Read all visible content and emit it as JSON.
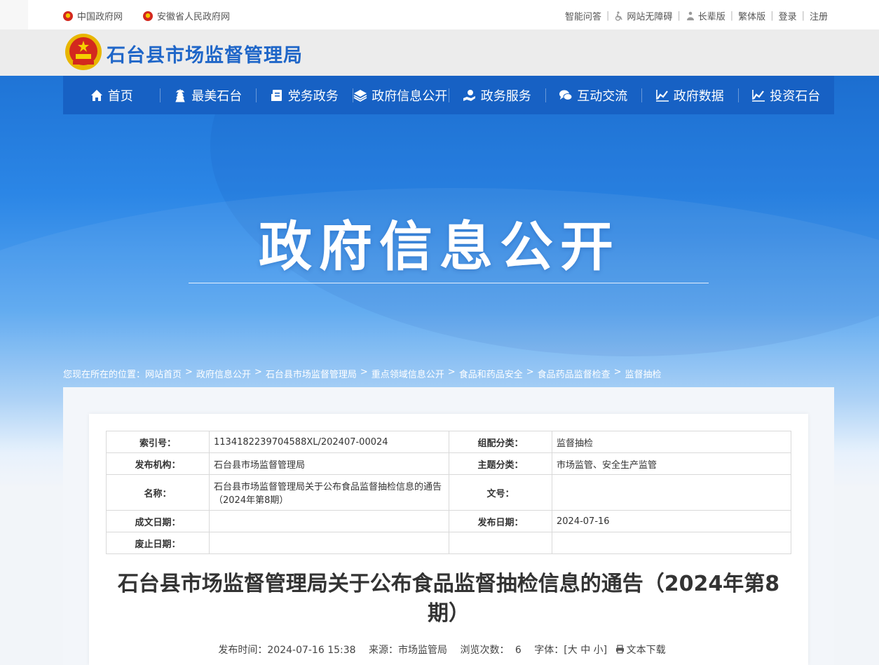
{
  "topbar": {
    "left_links": [
      "中国政府网",
      "安徽省人民政府网"
    ],
    "right_links": {
      "qa": "智能问答",
      "accessible": "网站无障碍",
      "elder": "长辈版",
      "traditional": "繁体版",
      "login": "登录",
      "register": "注册"
    }
  },
  "header": {
    "site_title": "石台县市场监督管理局"
  },
  "nav": {
    "items": [
      {
        "label": "首页",
        "icon": "home-icon"
      },
      {
        "label": "最美石台",
        "icon": "pagoda-icon"
      },
      {
        "label": "党务政务",
        "icon": "document-icon"
      },
      {
        "label": "政府信息公开",
        "icon": "layers-icon"
      },
      {
        "label": "政务服务",
        "icon": "hand-service-icon"
      },
      {
        "label": "互动交流",
        "icon": "chat-icon"
      },
      {
        "label": "政府数据",
        "icon": "chart-icon"
      },
      {
        "label": "投资石台",
        "icon": "chart-icon"
      }
    ]
  },
  "banner": {
    "title": "政府信息公开"
  },
  "breadcrumb": {
    "prefix": "您现在所在的位置：",
    "items": [
      "网站首页",
      "政府信息公开",
      "石台县市场监督管理局",
      "重点领域信息公开",
      "食品和药品安全",
      "食品药品监督检查",
      "监督抽检"
    ],
    "separator": ">"
  },
  "meta_table": {
    "index_label": "索引号：",
    "index_value": "1134182239704588XL/202407-00024",
    "category_label": "组配分类：",
    "category_value": "监督抽检",
    "publisher_label": "发布机构：",
    "publisher_value": "石台县市场监督管理局",
    "topic_label": "主题分类：",
    "topic_value": "市场监管、安全生产监管",
    "name_label": "名称：",
    "name_value": "石台县市场监督管理局关于公布食品监督抽检信息的通告（2024年第8期）",
    "docno_label": "文号：",
    "docno_value": "",
    "created_label": "成文日期：",
    "created_value": "",
    "published_label": "发布日期：",
    "published_value": "2024-07-16",
    "abolished_label": "废止日期：",
    "abolished_value": ""
  },
  "document": {
    "title": "石台县市场监督管理局关于公布食品监督抽检信息的通告（2024年第8期）",
    "publish_time": "发布时间：2024-07-16 15:38",
    "source": "来源：市场监管局",
    "views_label": "浏览次数：",
    "views": "6",
    "font_label": "字体：[",
    "font_large": "大",
    "font_medium": "中",
    "font_small": "小",
    "font_close": "]",
    "download": "文本下载"
  },
  "colors": {
    "nav_bg": "#1761c4",
    "title_blue": "#1f66c8"
  }
}
